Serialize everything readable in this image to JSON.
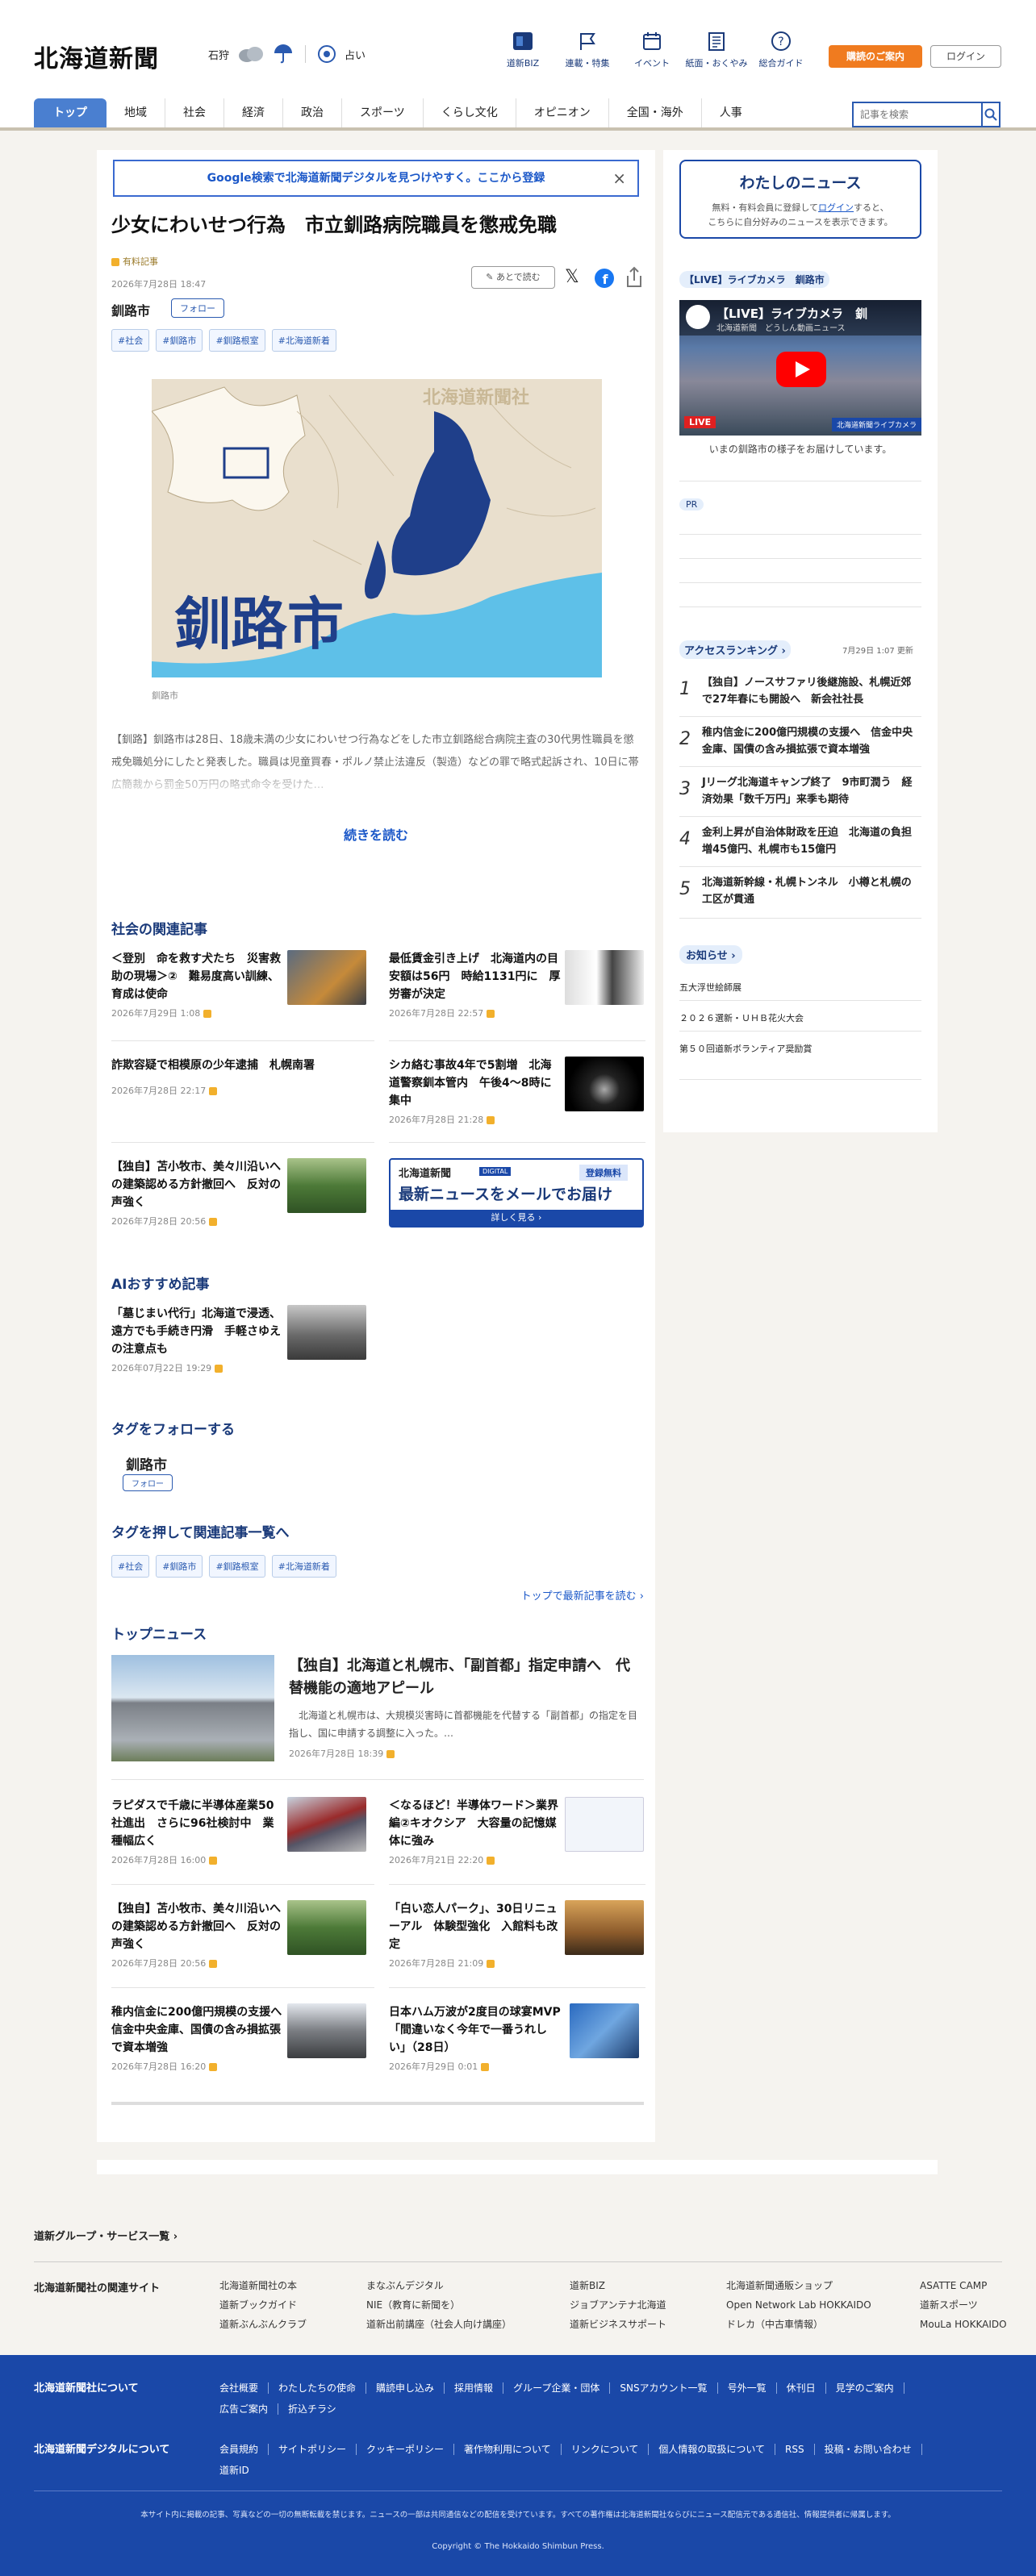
{
  "header": {
    "logo": "北海道新聞",
    "weather_city": "石狩",
    "fortune": "占い",
    "icons": [
      {
        "name": "biz-icon",
        "label": "道新BIZ"
      },
      {
        "name": "report-icon",
        "label": "連載・特集"
      },
      {
        "name": "calendar-icon",
        "label": "イベント"
      },
      {
        "name": "newspaper-icon",
        "label": "紙面・おくやみ"
      },
      {
        "name": "help-icon",
        "label": "総合ガイド"
      }
    ],
    "subscribe": "購読のご案内",
    "login": "ログイン",
    "search_placeholder": "記事を検索"
  },
  "nav": [
    "トップ",
    "地域",
    "社会",
    "経済",
    "政治",
    "スポーツ",
    "くらし文化",
    "オピニオン",
    "全国・海外",
    "人事"
  ],
  "banner": {
    "text": "Google検索で北海道新聞デジタルを見つけやすく。ここから登録",
    "close": "×"
  },
  "article": {
    "title": "少女にわいせつ行為　市立釧路病院職員を懲戒免職",
    "badge": "有料記事",
    "date": "2026年7月28日 18:47",
    "read_later": "あとで読む",
    "area": "釧路市",
    "follow": "フォロー",
    "tags": [
      "#社会",
      "#釧路市",
      "#釧路根室",
      "#北海道新着"
    ],
    "map_city": "釧路市",
    "map_watermark": "北海道新聞社",
    "caption": "釧路市",
    "body": "【釧路】釧路市は28日、18歳未満の少女にわいせつ行為などをした市立釧路総合病院主査の30代男性職員を懲戒免職処分にしたと発表した。職員は児童買春・ポルノ禁止法違反（製造）などの罪で略式起訴され、10日に帯広簡裁から罰金50万円の略式命令を受けた…",
    "continue": "続きを読む"
  },
  "related": {
    "heading": "社会の関連記事",
    "items": [
      {
        "title": "＜登別　命を救す犬たち　災害救助の現場＞②　難易度高い訓練、育成は使命",
        "date": "2026年7月29日 1:08"
      },
      {
        "title": "最低賃金引き上げ　北海道内の目安額は56円　時給1131円に　厚労審が決定",
        "date": "2026年7月28日 22:57"
      },
      {
        "title": "詐欺容疑で相模原の少年逮捕　札幌南署",
        "date": "2026年7月28日 22:17"
      },
      {
        "title": "シカ絡む事故4年で5割増　北海道警察釧本管内　午後4〜8時に集中",
        "date": "2026年7月28日 21:28"
      },
      {
        "title": "【独自】苫小牧市、美々川沿いへの建築認める方針撤回へ　反対の声強く",
        "date": "2026年7月28日 20:56"
      }
    ],
    "mail_ad": {
      "logo": "北海道新聞",
      "tag": "DIGITAL",
      "badge": "登録無料",
      "text": "最新ニュースをメールでお届け",
      "more": "詳しく見る"
    }
  },
  "ai": {
    "heading": "AIおすすめ記事",
    "item": {
      "title": "「墓じまい代行」北海道で浸透、遠方でも手続き円滑　手軽さゆえの注意点も",
      "date": "2026年07月22日 19:29"
    }
  },
  "follow_tags": {
    "heading": "タグをフォローする",
    "area": "釧路市",
    "follow": "フォロー"
  },
  "tag_list": {
    "heading": "タグを押して関連記事一覧へ",
    "tags": [
      "#社会",
      "#釧路市",
      "#釧路根室",
      "#北海道新着"
    ],
    "more": "トップで最新記事を読む"
  },
  "top_news": {
    "heading": "トップニュース",
    "lead": {
      "title": "【独自】北海道と札幌市、「副首都」指定申請へ　代替機能の適地アピール",
      "summary": "　北海道と札幌市は、大規模災害時に首都機能を代替する「副首都」の指定を目指し、国に申請する調整に入った。…",
      "date": "2026年7月28日 18:39"
    },
    "items": [
      {
        "title": "ラピダスで千歳に半導体産業50社進出　さらに96社検討中　業種幅広く",
        "date": "2026年7月28日 16:00"
      },
      {
        "title": "＜なるほど！半導体ワード＞業界編②キオクシア　大容量の記憶媒体に強み",
        "date": "2026年7月21日 22:20"
      },
      {
        "title": "【独自】苫小牧市、美々川沿いへの建築認める方針撤回へ　反対の声強く",
        "date": "2026年7月28日 20:56"
      },
      {
        "title": "「白い恋人パーク」、30日リニューアル　体験型強化　入館料も改定",
        "date": "2026年7月28日 21:09"
      },
      {
        "title": "稚内信金に200億円規模の支援へ　信金中央金庫、国債の含み損拡張で資本増強",
        "date": "2026年7月28日 16:20"
      },
      {
        "title": "日本ハム万波が2度目の球宴MVP　「間違いなく今年で一番うれしい」（28日）",
        "date": "2026年7月29日 0:01"
      }
    ]
  },
  "side": {
    "watashi": {
      "title": "わたしのニュース",
      "text1": "無料・有料会員に登録して",
      "login": "ログイン",
      "text2": "すると、",
      "text3": "こちらに自分好みのニュースを表示できます。"
    },
    "live": {
      "label": "【LIVE】ライブカメラ　釧路市",
      "video_title": "【LIVE】ライブカメラ　釧",
      "channel": "北海道新聞　どうしん動画ニュース",
      "live_badge": "LIVE",
      "corner": "北海道新聞ライブカメラ",
      "caption": "いまの釧路市の様子をお届けしています。"
    },
    "pr": "PR",
    "ranking": {
      "heading": "アクセスランキング",
      "updated": "7月29日 1:07 更新",
      "items": [
        {
          "no": "1",
          "title": "【独自】ノースサファリ後継施設、札幌近郊で27年春にも開設へ　新会社社長"
        },
        {
          "no": "2",
          "title": "稚内信金に200億円規模の支援へ　信金中央金庫、国債の含み損拡張で資本増強"
        },
        {
          "no": "3",
          "title": "Jリーグ北海道キャンプ終了　9市町潤う　経済効果「数千万円」来季も期待"
        },
        {
          "no": "4",
          "title": "金利上昇が自治体財政を圧迫　北海道の負担増45億円、札幌市も15億円"
        },
        {
          "no": "5",
          "title": "北海道新幹線・札幌トンネル　小樽と札幌の工区が貫通"
        }
      ]
    },
    "notice": {
      "heading": "お知らせ",
      "items": [
        "五大浮世絵師展",
        "２０２６選新・ＵＨＢ花火大会",
        "第５０回道新ボランティア奨励賞"
      ]
    }
  },
  "footer": {
    "group": "道新グループ・サービス一覧",
    "related_label": "北海道新聞社の関連サイト",
    "cols": [
      [
        "北海道新聞社の本",
        "道新ブックガイド",
        "道新ぶんぶんクラブ"
      ],
      [
        "まなぶんデジタル",
        "NIE（教育に新聞を）",
        "道新出前講座（社会人向け講座）"
      ],
      [
        "道新BIZ",
        "ジョブアンテナ北海道",
        "道新ビジネスサポート"
      ],
      [
        "北海道新聞通販ショップ",
        "Open Network Lab HOKKAIDO",
        "ドレカ（中古車情報）"
      ],
      [
        "ASATTE CAMP",
        "道新スポーツ",
        "MouLa HOKKAIDO"
      ]
    ],
    "company_label": "北海道新聞社について",
    "company_links": [
      "会社概要",
      "わたしたちの使命",
      "購読申し込み",
      "採用情報",
      "グループ企業・団体",
      "SNSアカウント一覧",
      "号外一覧",
      "休刊日",
      "見学のご案内",
      "広告ご案内",
      "折込チラシ"
    ],
    "digital_label": "北海道新聞デジタルについて",
    "digital_links": [
      "会員規約",
      "サイトポリシー",
      "クッキーポリシー",
      "著作物利用について",
      "リンクについて",
      "個人情報の取扱について",
      "RSS",
      "投稿・お問い合わせ",
      "道新ID"
    ],
    "notice": "本サイト内に掲載の記事、写真などの一切の無断転載を禁じます。ニュースの一部は共同通信などの配信を受けています。すべての著作権は北海道新聞社ならびにニュース配信元である通信社、情報提供者に帰属します。",
    "copyright": "Copyright © The Hokkaido Shimbun Press."
  }
}
